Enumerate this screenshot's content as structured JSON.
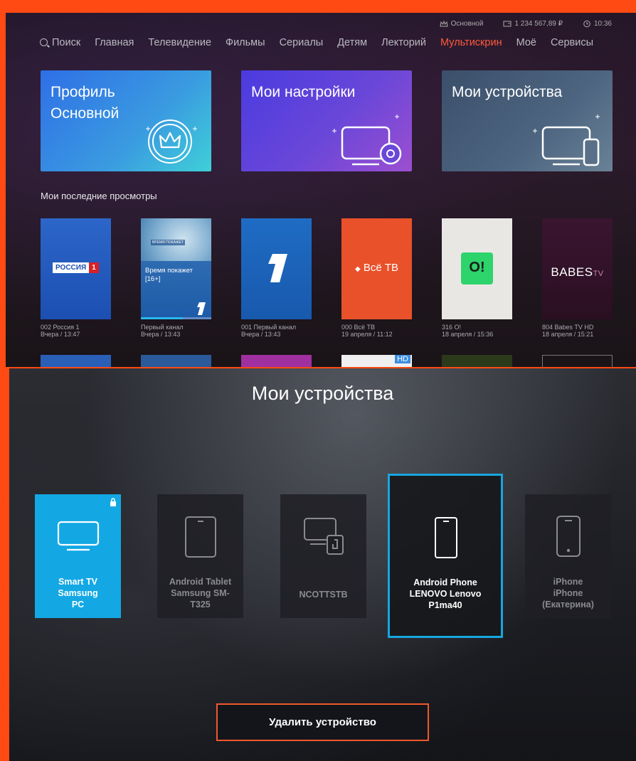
{
  "top": {
    "status": {
      "profile": "Основной",
      "balance": "1 234 567,89 ₽",
      "time": "10:36"
    },
    "nav": {
      "search": "Поиск",
      "items": [
        "Главная",
        "Телевидение",
        "Фильмы",
        "Сериалы",
        "Детям",
        "Лекторий",
        "Мультискрин",
        "Моё",
        "Сервисы"
      ],
      "active": "Мультискрин"
    },
    "tiles": {
      "profile_line1": "Профиль",
      "profile_line2": "Основной",
      "settings": "Мои настройки",
      "devices": "Мои устройства"
    },
    "recent_title": "Мои последние просмотры",
    "cards": [
      {
        "line1": "002 Россия 1",
        "line2": "Вчера / 13:47",
        "logo_a": "РОССИЯ",
        "logo_b": "1"
      },
      {
        "line1": "Первый канал",
        "line2": "Вчера / 13:43",
        "show": "Время покажет",
        "rating": "[16+]",
        "thumb_label": "ВРЕМЯ ПОКАЖЕТ",
        "progress": 0.6
      },
      {
        "line1": "001 Первый канал",
        "line2": "Вчера / 13:43"
      },
      {
        "line1": "000 Всё ТВ",
        "line2": "19 апреля / 11:12",
        "logo": "Всё ТВ"
      },
      {
        "line1": "316 О!",
        "line2": "18 апреля / 15:36",
        "logo": "О!"
      },
      {
        "line1": "804 Babes TV HD",
        "line2": "18 апреля / 15:21",
        "logo": "BABES",
        "logo_suffix": "TV"
      }
    ],
    "peek_hd": "HD"
  },
  "bottom": {
    "title": "Мои устройства",
    "devices": [
      {
        "l1": "Smart TV",
        "l2": "Samsung",
        "l3": "PC",
        "icon": "tv-icon",
        "state": "active-locked"
      },
      {
        "l1": "Android Tablet",
        "l2": "Samsung SM-",
        "l3": "T325",
        "icon": "tablet-icon",
        "state": "inactive"
      },
      {
        "l1": "NCOTTSTB",
        "l2": "",
        "l3": "",
        "icon": "set-top-box-icon",
        "state": "inactive"
      },
      {
        "l1": "Android Phone",
        "l2": "LENOVO Lenovo",
        "l3": "P1ma40",
        "icon": "phone-icon",
        "state": "focused"
      },
      {
        "l1": "iPhone",
        "l2": "iPhone",
        "l3": "(Екатерина)",
        "icon": "iphone-icon",
        "state": "inactive"
      }
    ],
    "delete_label": "Удалить устройство"
  },
  "colors": {
    "accent": "#ff5a3c",
    "focus": "#17a6e0",
    "active_device": "#13a8e4",
    "frame": "#ff4a14"
  }
}
